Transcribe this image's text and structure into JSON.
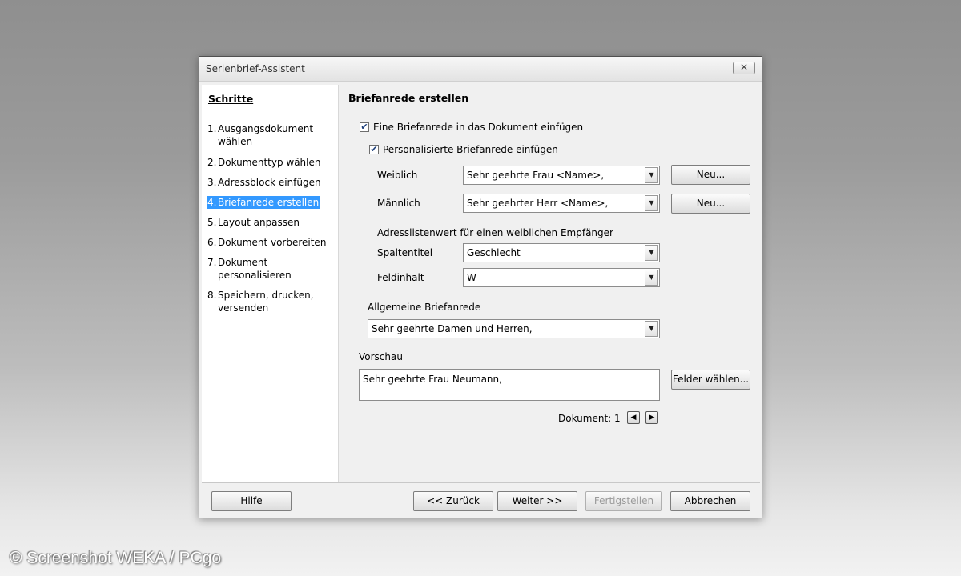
{
  "window": {
    "title": "Serienbrief-Assistent",
    "close_glyph": "✕"
  },
  "sidebar": {
    "title": "Schritte",
    "steps": [
      {
        "num": "1.",
        "label": "Ausgangsdokument wählen"
      },
      {
        "num": "2.",
        "label": "Dokumenttyp wählen"
      },
      {
        "num": "3.",
        "label": "Adressblock einfügen"
      },
      {
        "num": "4.",
        "label": "Briefanrede erstellen"
      },
      {
        "num": "5.",
        "label": "Layout anpassen"
      },
      {
        "num": "6.",
        "label": "Dokument vorbereiten"
      },
      {
        "num": "7.",
        "label": "Dokument personalisieren"
      },
      {
        "num": "8.",
        "label": "Speichern, drucken, versenden"
      }
    ],
    "active_step": 4
  },
  "main": {
    "heading": "Briefanrede erstellen",
    "insert_salutation": {
      "label": "Eine Briefanrede in das Dokument einfügen",
      "checked": true
    },
    "personalized": {
      "label": "Personalisierte Briefanrede einfügen",
      "checked": true
    },
    "female": {
      "label": "Weiblich",
      "value": "Sehr geehrte Frau <Name>,",
      "new_button": "Neu..."
    },
    "male": {
      "label": "Männlich",
      "value": "Sehr geehrter Herr <Name>,",
      "new_button": "Neu..."
    },
    "address_list_label": "Adresslistenwert für einen weiblichen Empfänger",
    "column_title": {
      "label": "Spaltentitel",
      "value": "Geschlecht"
    },
    "field_content": {
      "label": "Feldinhalt",
      "value": "W"
    },
    "general": {
      "label": "Allgemeine Briefanrede",
      "value": "Sehr geehrte Damen und Herren,"
    },
    "preview": {
      "label": "Vorschau",
      "value": "Sehr geehrte Frau Neumann,",
      "fields_button": "Felder wählen..."
    },
    "document_nav": {
      "label": "Dokument: 1",
      "prev_glyph": "◀",
      "next_glyph": "▶"
    }
  },
  "footer": {
    "help": "Hilfe",
    "back": "<< Zurück",
    "next": "Weiter >>",
    "finish": "Fertigstellen",
    "cancel": "Abbrechen"
  },
  "watermark": "© Screenshot WEKA / PCgo"
}
